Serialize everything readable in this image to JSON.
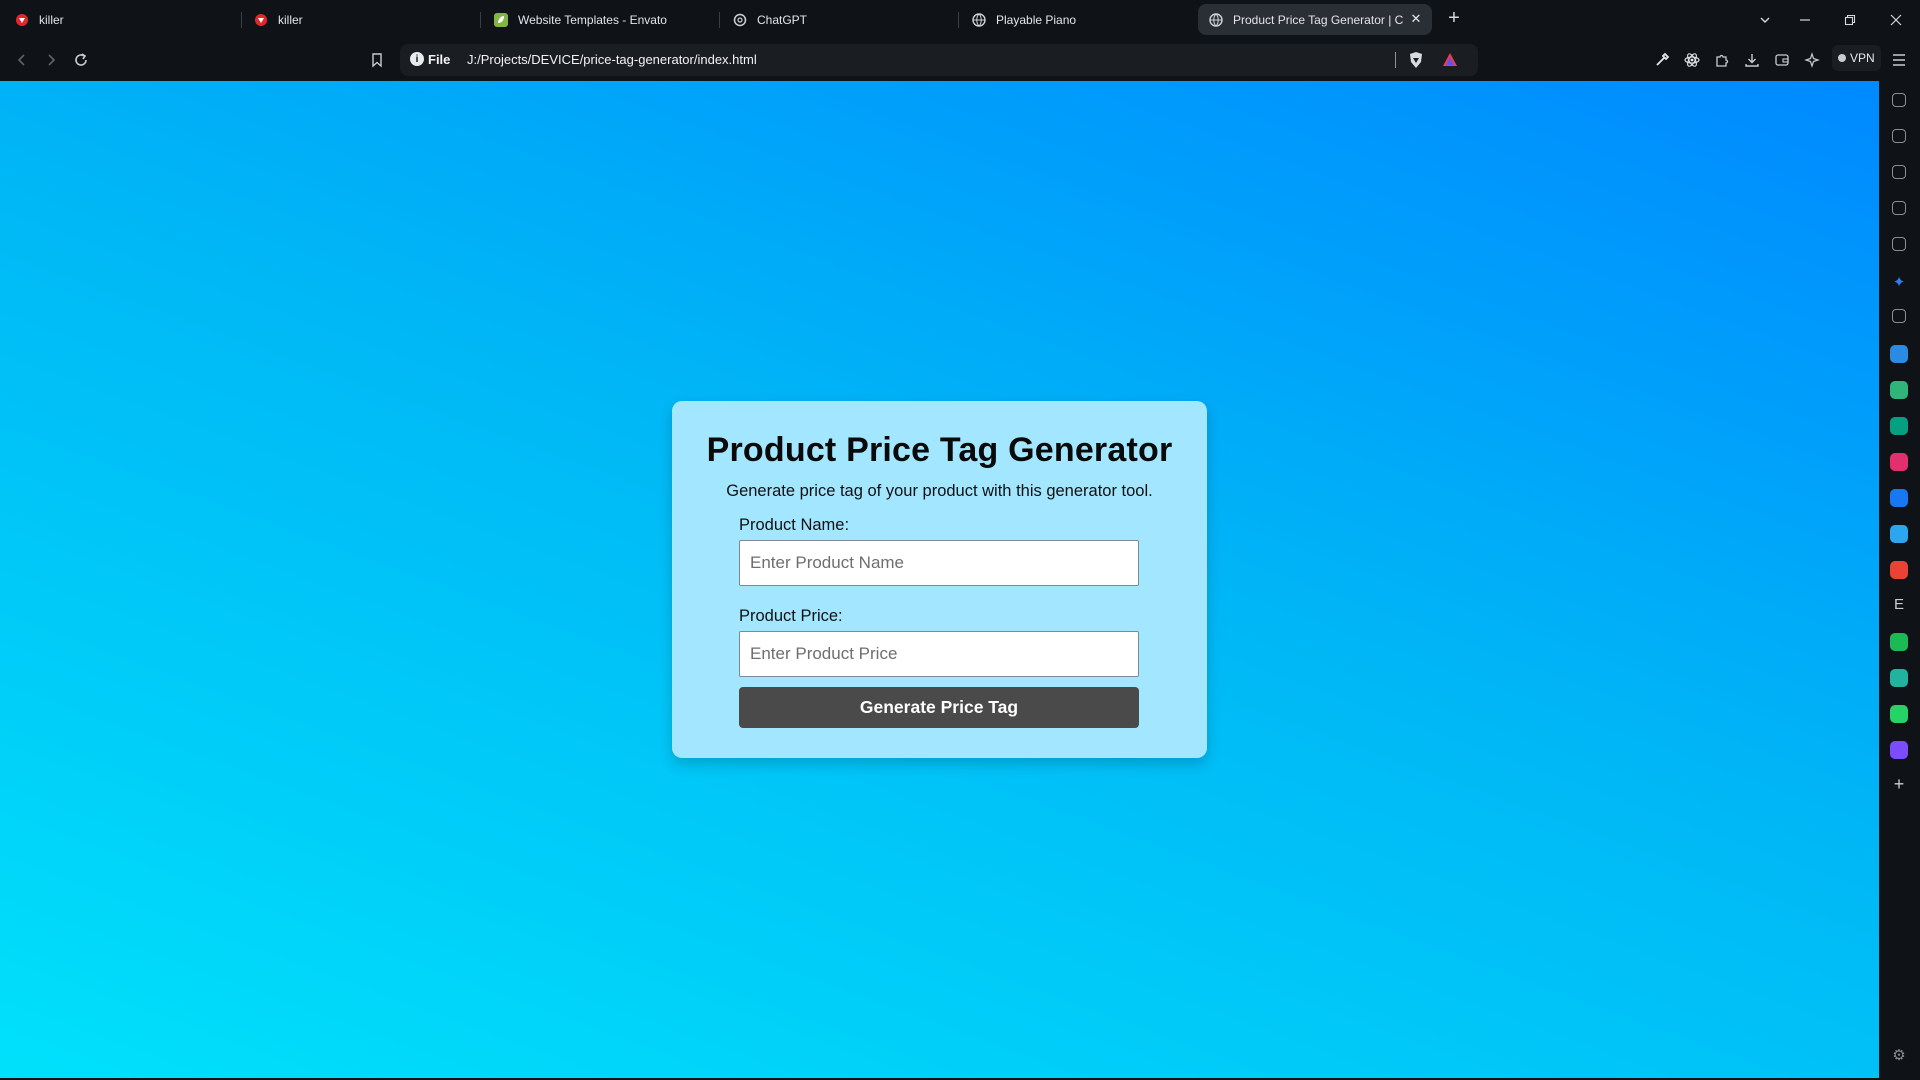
{
  "browser": {
    "tabs": [
      {
        "title": "killer",
        "icon": "brave-lion-icon",
        "color": "#e2262b"
      },
      {
        "title": "killer",
        "icon": "brave-lion-icon",
        "color": "#e2262b"
      },
      {
        "title": "Website Templates - Envato",
        "icon": "envato-leaf-icon",
        "color": "#82b541"
      },
      {
        "title": "ChatGPT",
        "icon": "chatgpt-icon",
        "color": "#cfd2d6"
      },
      {
        "title": "Playable Piano",
        "icon": "globe-icon",
        "color": "#cfd2d6"
      },
      {
        "title": "Product Price Tag Generator | C",
        "icon": "globe-icon",
        "color": "#cfd2d6",
        "active": true
      }
    ],
    "new_tab": "+",
    "address": {
      "scheme": "File",
      "url": "J:/Projects/DEVICE/price-tag-generator/index.html"
    },
    "vpn_label": "VPN"
  },
  "page": {
    "title": "Product Price Tag Generator",
    "subtitle": "Generate price tag of your product with this generator tool.",
    "name_label": "Product Name:",
    "name_placeholder": "Enter Product Name",
    "name_value": "",
    "price_label": "Product Price:",
    "price_placeholder": "Enter Product Price",
    "price_value": "",
    "button_label": "Generate Price Tag"
  },
  "sidebar": {
    "items": [
      {
        "name": "leo-ai-icon",
        "color": "#8a8f96"
      },
      {
        "name": "video-icon",
        "color": "#8a8f96"
      },
      {
        "name": "wallet-icon",
        "color": "#8a8f96"
      },
      {
        "name": "bookmarks-icon",
        "color": "#8a8f96"
      },
      {
        "name": "reading-list-icon",
        "color": "#8a8f96"
      },
      {
        "name": "sparkle-icon",
        "color": "#2f7cf6"
      },
      {
        "name": "globe-app-icon",
        "color": "#8a8f96"
      },
      {
        "name": "malwarebytes-icon",
        "color": "#2b8be0"
      },
      {
        "name": "dribbble-square-icon",
        "color": "#2fb57a"
      },
      {
        "name": "pexels-icon",
        "color": "#05a081"
      },
      {
        "name": "instagram-icon",
        "color": "#e1306c"
      },
      {
        "name": "facebook-icon",
        "color": "#1877f2"
      },
      {
        "name": "refresh-app-icon",
        "color": "#2aa7ee"
      },
      {
        "name": "gmail-icon",
        "color": "#ea4335"
      },
      {
        "name": "e-app-icon",
        "color": "#c9ccd1"
      },
      {
        "name": "spotify-icon",
        "color": "#1db954"
      },
      {
        "name": "chat-app-icon",
        "color": "#1fb3a0"
      },
      {
        "name": "whatsapp-icon",
        "color": "#25d366"
      },
      {
        "name": "messenger-icon",
        "color": "#7b4dff"
      },
      {
        "name": "add-panel-icon",
        "color": "#c9ccd1"
      }
    ],
    "settings": "settings-icon"
  }
}
